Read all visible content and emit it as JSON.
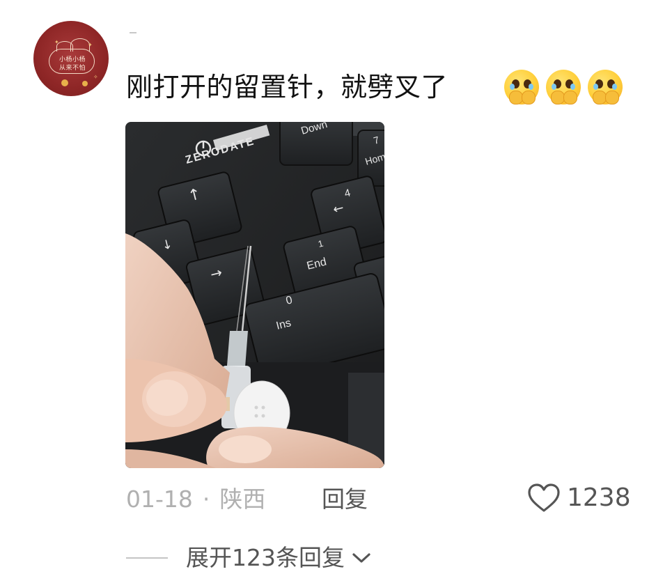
{
  "comment": {
    "avatar_text": [
      "小杨小杨",
      "从来不怕"
    ],
    "text": "刚打开的留置针，就劈叉了",
    "emojis": [
      "crying-face-emoji",
      "crying-face-emoji",
      "crying-face-emoji"
    ]
  },
  "photo": {
    "description_icon": "keyboard-photo",
    "keys": {
      "page_down": "Down",
      "home": "Hom",
      "num_seven": "7",
      "num_four": "4",
      "num_one": "1",
      "num_zero": "0",
      "end": "End",
      "ins": "Ins",
      "brand": "ZERODATE"
    }
  },
  "meta": {
    "date": "01-18",
    "separator": "·",
    "location": "陕西",
    "reply_label": "回复"
  },
  "like": {
    "count": "1238",
    "icon": "heart-outline-icon"
  },
  "expand": {
    "label": "展开123条回复",
    "icon": "chevron-down-icon"
  },
  "colors": {
    "text_primary": "#111111",
    "text_secondary": "#555555",
    "text_muted": "#b0b0b0",
    "avatar_bg": "#8e2626"
  }
}
